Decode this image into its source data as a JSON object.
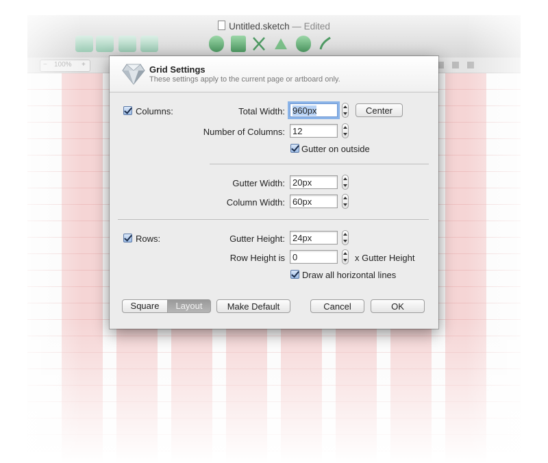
{
  "window": {
    "filename": "Untitled.sketch",
    "edited_label": "— Edited",
    "zoom_minus": "−",
    "zoom_value": "100%",
    "zoom_plus": "+"
  },
  "dialog": {
    "title": "Grid Settings",
    "subtitle": "These settings apply to the current page or artboard only.",
    "icon": "sketch-diamond-icon",
    "columns": {
      "label": "Columns:",
      "checked": true,
      "total_width_label": "Total Width:",
      "total_width_value": "960px",
      "center_button": "Center",
      "number_label": "Number of Columns:",
      "number_value": "12",
      "gutter_outside_label": "Gutter on outside",
      "gutter_outside_checked": true,
      "gutter_width_label": "Gutter Width:",
      "gutter_width_value": "20px",
      "column_width_label": "Column Width:",
      "column_width_value": "60px"
    },
    "rows": {
      "label": "Rows:",
      "checked": true,
      "gutter_height_label": "Gutter Height:",
      "gutter_height_value": "24px",
      "row_height_label": "Row Height is",
      "row_height_value": "0",
      "row_height_suffix": "x Gutter Height",
      "draw_lines_label": "Draw all horizontal lines",
      "draw_lines_checked": true
    },
    "buttons": {
      "square": "Square",
      "layout": "Layout",
      "make_default": "Make Default",
      "cancel": "Cancel",
      "ok": "OK"
    }
  },
  "colors": {
    "column_tint": "#eca0a0",
    "focus_ring": "#8bb4e8",
    "dialog_bg": "#ececec"
  }
}
